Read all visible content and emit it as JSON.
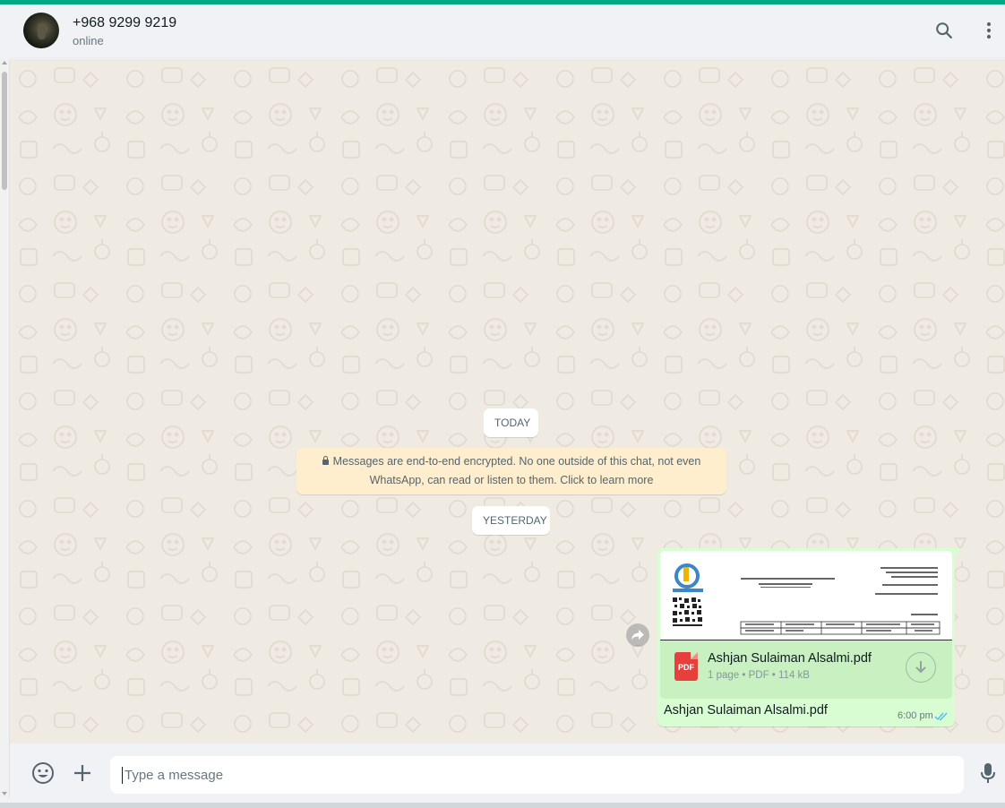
{
  "header": {
    "contact_name": "+968 9299 9219",
    "status": "online",
    "avatar_icon": "contact-avatar",
    "search_icon": "search-icon",
    "menu_icon": "menu-dots-icon"
  },
  "chat": {
    "date_today": "TODAY",
    "encryption_notice": "Messages are end-to-end encrypted. No one outside of this chat, not even WhatsApp, can read or listen to them. Click to learn more",
    "date_yesterday": "YESTERDAY",
    "messages": [
      {
        "direction": "outgoing",
        "document": {
          "file_name": "Ashjan Sulaiman Alsalmi.pdf",
          "meta": "1 page • PDF • 114 kB",
          "type_badge": "PDF"
        },
        "caption": "Ashjan Sulaiman Alsalmi.pdf",
        "time": "6:00 pm",
        "status": "read"
      }
    ]
  },
  "footer": {
    "placeholder": "Type a message",
    "emoji_icon": "emoji-icon",
    "attach_icon": "plus-icon",
    "mic_icon": "microphone-icon"
  },
  "colors": {
    "accent": "#00a884",
    "outgoing_bubble": "#d9fdd3",
    "notice_bg": "#ffeecd",
    "read_ticks": "#53bdeb",
    "pdf_red": "#e5403c"
  }
}
